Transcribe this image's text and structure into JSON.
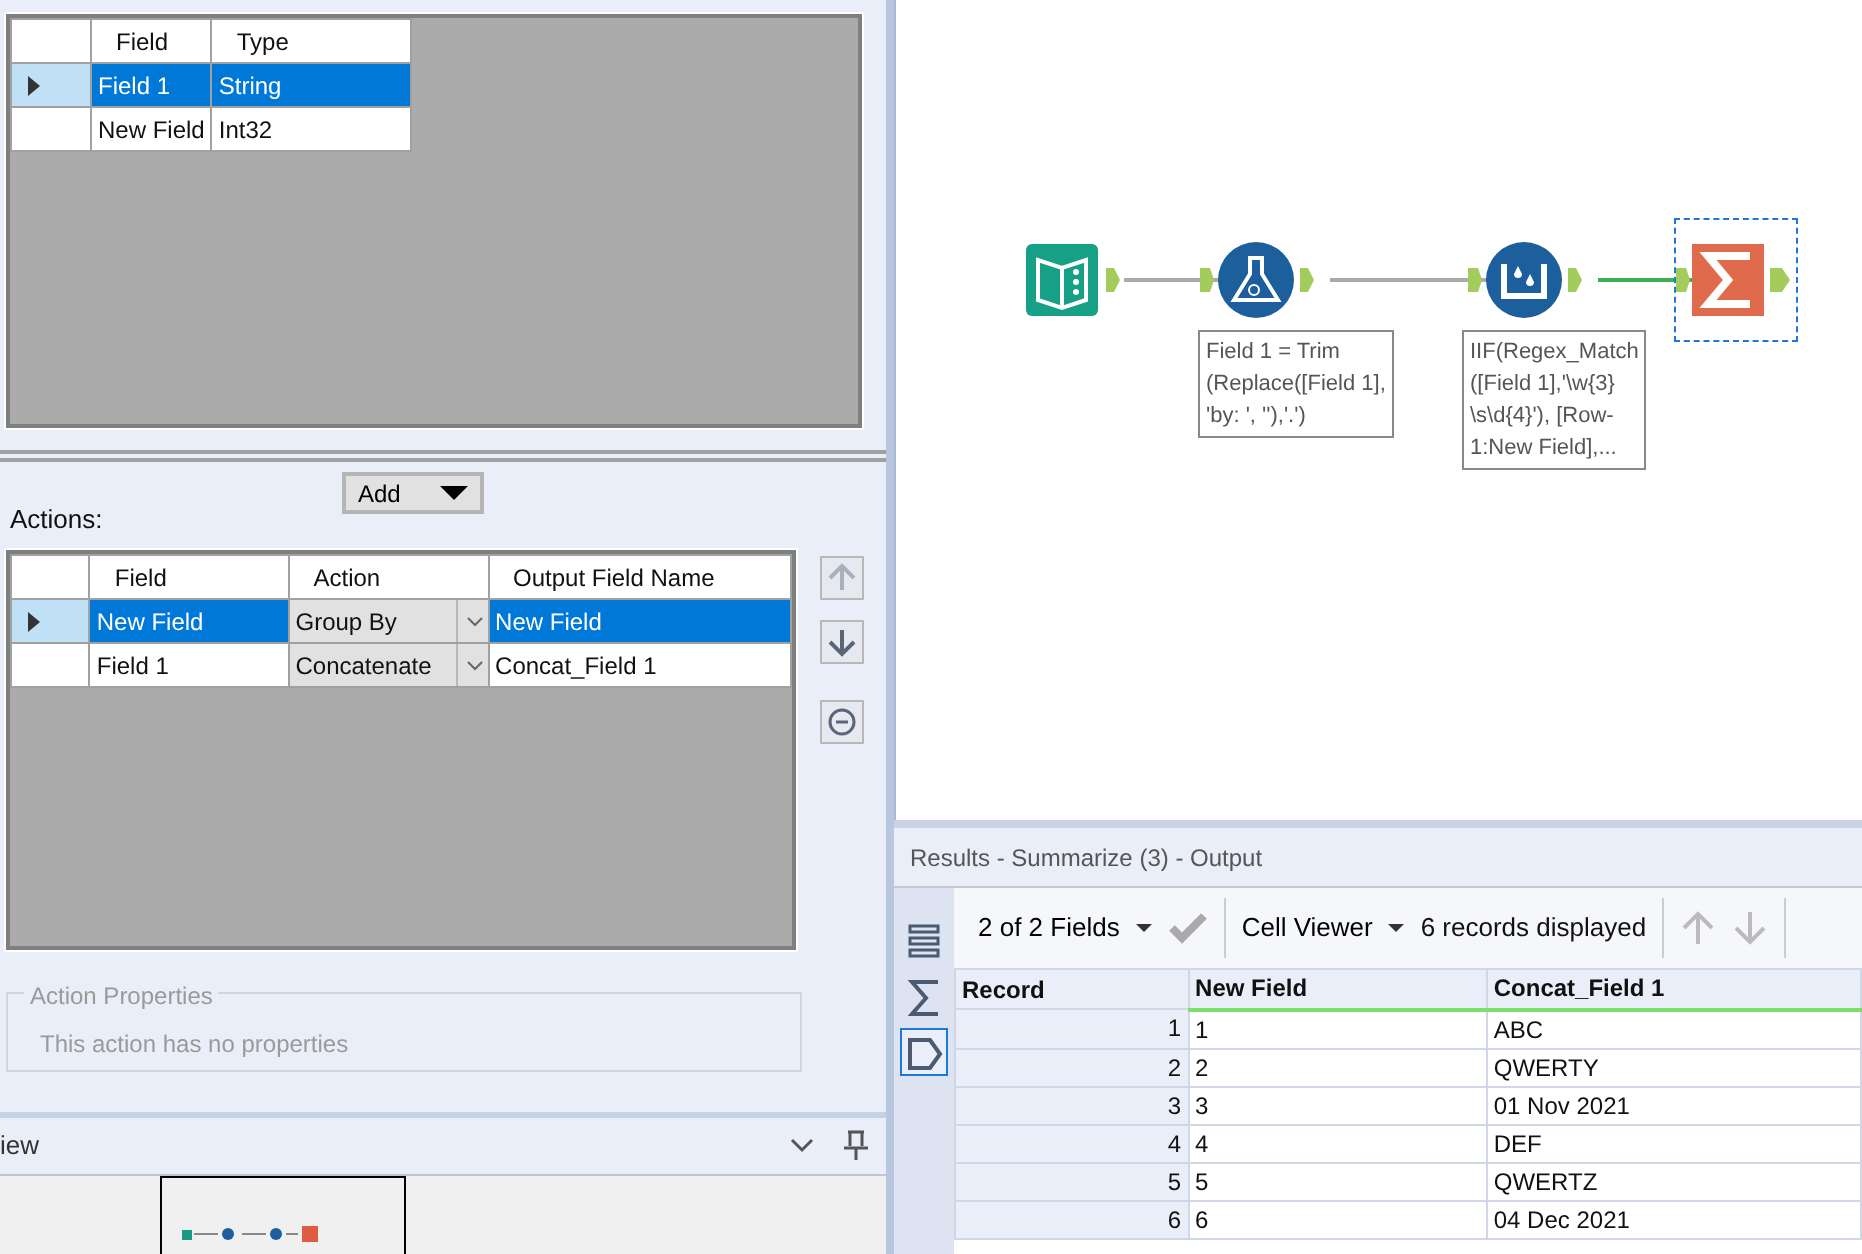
{
  "fields_grid": {
    "columns": [
      "Field",
      "Type"
    ],
    "rows": [
      {
        "field": "Field 1",
        "type": "String",
        "selected": true
      },
      {
        "field": "New Field",
        "type": "Int32",
        "selected": false
      }
    ]
  },
  "actions": {
    "label": "Actions:",
    "add_button": "Add",
    "columns": [
      "Field",
      "Action",
      "Output Field Name"
    ],
    "rows": [
      {
        "field": "New Field",
        "action": "Group By",
        "output": "New Field",
        "selected": true
      },
      {
        "field": "Field 1",
        "action": "Concatenate",
        "output": "Concat_Field 1",
        "selected": false
      }
    ]
  },
  "action_properties": {
    "title": "Action Properties",
    "text": "This action has no properties"
  },
  "overview": {
    "title": "iew"
  },
  "workflow": {
    "nodes": [
      {
        "kind": "input",
        "selected": false
      },
      {
        "kind": "formula",
        "selected": false,
        "annotation": "Field 1 = Trim\n(Replace([Field 1],\n'by: ', ''),'.')"
      },
      {
        "kind": "multirow",
        "selected": false,
        "annotation": "IIF(Regex_Match\n([Field 1],'\\w{3}\n\\s\\d{4}'), [Row-\n1:New Field],..."
      },
      {
        "kind": "summarize",
        "selected": true
      }
    ]
  },
  "results": {
    "title": "Results - Summarize (3) - Output",
    "fields_menu": "2 of 2 Fields",
    "viewer_menu": "Cell Viewer",
    "records_text": "6 records displayed",
    "rail": [
      {
        "kind": "list",
        "selected": false
      },
      {
        "kind": "sigma",
        "selected": false
      },
      {
        "kind": "tag",
        "selected": true
      }
    ],
    "columns": [
      "Record",
      "New Field",
      "Concat_Field 1"
    ],
    "rows": [
      [
        "1",
        "1",
        "ABC"
      ],
      [
        "2",
        "2",
        "QWERTY"
      ],
      [
        "3",
        "3",
        "01 Nov 2021"
      ],
      [
        "4",
        "4",
        "DEF"
      ],
      [
        "5",
        "5",
        "QWERTZ"
      ],
      [
        "6",
        "6",
        "04 Dec 2021"
      ]
    ]
  }
}
